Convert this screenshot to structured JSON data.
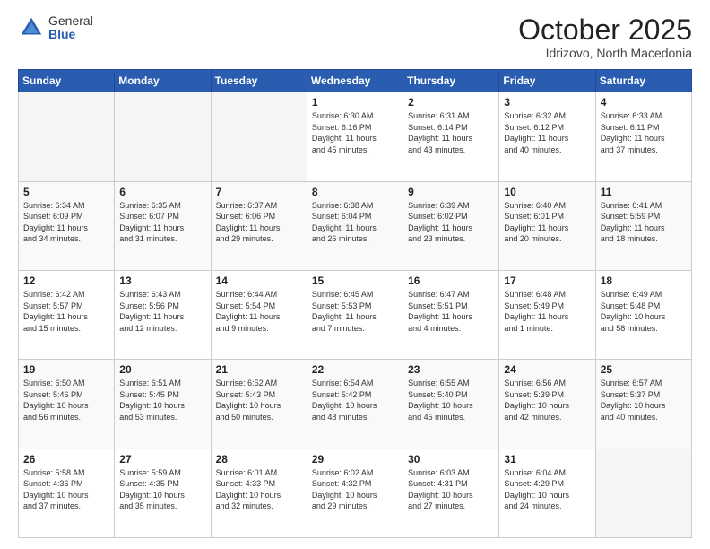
{
  "logo": {
    "general": "General",
    "blue": "Blue"
  },
  "header": {
    "month": "October 2025",
    "location": "Idrizovo, North Macedonia"
  },
  "weekdays": [
    "Sunday",
    "Monday",
    "Tuesday",
    "Wednesday",
    "Thursday",
    "Friday",
    "Saturday"
  ],
  "weeks": [
    [
      {
        "day": "",
        "info": ""
      },
      {
        "day": "",
        "info": ""
      },
      {
        "day": "",
        "info": ""
      },
      {
        "day": "1",
        "info": "Sunrise: 6:30 AM\nSunset: 6:16 PM\nDaylight: 11 hours\nand 45 minutes."
      },
      {
        "day": "2",
        "info": "Sunrise: 6:31 AM\nSunset: 6:14 PM\nDaylight: 11 hours\nand 43 minutes."
      },
      {
        "day": "3",
        "info": "Sunrise: 6:32 AM\nSunset: 6:12 PM\nDaylight: 11 hours\nand 40 minutes."
      },
      {
        "day": "4",
        "info": "Sunrise: 6:33 AM\nSunset: 6:11 PM\nDaylight: 11 hours\nand 37 minutes."
      }
    ],
    [
      {
        "day": "5",
        "info": "Sunrise: 6:34 AM\nSunset: 6:09 PM\nDaylight: 11 hours\nand 34 minutes."
      },
      {
        "day": "6",
        "info": "Sunrise: 6:35 AM\nSunset: 6:07 PM\nDaylight: 11 hours\nand 31 minutes."
      },
      {
        "day": "7",
        "info": "Sunrise: 6:37 AM\nSunset: 6:06 PM\nDaylight: 11 hours\nand 29 minutes."
      },
      {
        "day": "8",
        "info": "Sunrise: 6:38 AM\nSunset: 6:04 PM\nDaylight: 11 hours\nand 26 minutes."
      },
      {
        "day": "9",
        "info": "Sunrise: 6:39 AM\nSunset: 6:02 PM\nDaylight: 11 hours\nand 23 minutes."
      },
      {
        "day": "10",
        "info": "Sunrise: 6:40 AM\nSunset: 6:01 PM\nDaylight: 11 hours\nand 20 minutes."
      },
      {
        "day": "11",
        "info": "Sunrise: 6:41 AM\nSunset: 5:59 PM\nDaylight: 11 hours\nand 18 minutes."
      }
    ],
    [
      {
        "day": "12",
        "info": "Sunrise: 6:42 AM\nSunset: 5:57 PM\nDaylight: 11 hours\nand 15 minutes."
      },
      {
        "day": "13",
        "info": "Sunrise: 6:43 AM\nSunset: 5:56 PM\nDaylight: 11 hours\nand 12 minutes."
      },
      {
        "day": "14",
        "info": "Sunrise: 6:44 AM\nSunset: 5:54 PM\nDaylight: 11 hours\nand 9 minutes."
      },
      {
        "day": "15",
        "info": "Sunrise: 6:45 AM\nSunset: 5:53 PM\nDaylight: 11 hours\nand 7 minutes."
      },
      {
        "day": "16",
        "info": "Sunrise: 6:47 AM\nSunset: 5:51 PM\nDaylight: 11 hours\nand 4 minutes."
      },
      {
        "day": "17",
        "info": "Sunrise: 6:48 AM\nSunset: 5:49 PM\nDaylight: 11 hours\nand 1 minute."
      },
      {
        "day": "18",
        "info": "Sunrise: 6:49 AM\nSunset: 5:48 PM\nDaylight: 10 hours\nand 58 minutes."
      }
    ],
    [
      {
        "day": "19",
        "info": "Sunrise: 6:50 AM\nSunset: 5:46 PM\nDaylight: 10 hours\nand 56 minutes."
      },
      {
        "day": "20",
        "info": "Sunrise: 6:51 AM\nSunset: 5:45 PM\nDaylight: 10 hours\nand 53 minutes."
      },
      {
        "day": "21",
        "info": "Sunrise: 6:52 AM\nSunset: 5:43 PM\nDaylight: 10 hours\nand 50 minutes."
      },
      {
        "day": "22",
        "info": "Sunrise: 6:54 AM\nSunset: 5:42 PM\nDaylight: 10 hours\nand 48 minutes."
      },
      {
        "day": "23",
        "info": "Sunrise: 6:55 AM\nSunset: 5:40 PM\nDaylight: 10 hours\nand 45 minutes."
      },
      {
        "day": "24",
        "info": "Sunrise: 6:56 AM\nSunset: 5:39 PM\nDaylight: 10 hours\nand 42 minutes."
      },
      {
        "day": "25",
        "info": "Sunrise: 6:57 AM\nSunset: 5:37 PM\nDaylight: 10 hours\nand 40 minutes."
      }
    ],
    [
      {
        "day": "26",
        "info": "Sunrise: 5:58 AM\nSunset: 4:36 PM\nDaylight: 10 hours\nand 37 minutes."
      },
      {
        "day": "27",
        "info": "Sunrise: 5:59 AM\nSunset: 4:35 PM\nDaylight: 10 hours\nand 35 minutes."
      },
      {
        "day": "28",
        "info": "Sunrise: 6:01 AM\nSunset: 4:33 PM\nDaylight: 10 hours\nand 32 minutes."
      },
      {
        "day": "29",
        "info": "Sunrise: 6:02 AM\nSunset: 4:32 PM\nDaylight: 10 hours\nand 29 minutes."
      },
      {
        "day": "30",
        "info": "Sunrise: 6:03 AM\nSunset: 4:31 PM\nDaylight: 10 hours\nand 27 minutes."
      },
      {
        "day": "31",
        "info": "Sunrise: 6:04 AM\nSunset: 4:29 PM\nDaylight: 10 hours\nand 24 minutes."
      },
      {
        "day": "",
        "info": ""
      }
    ]
  ]
}
